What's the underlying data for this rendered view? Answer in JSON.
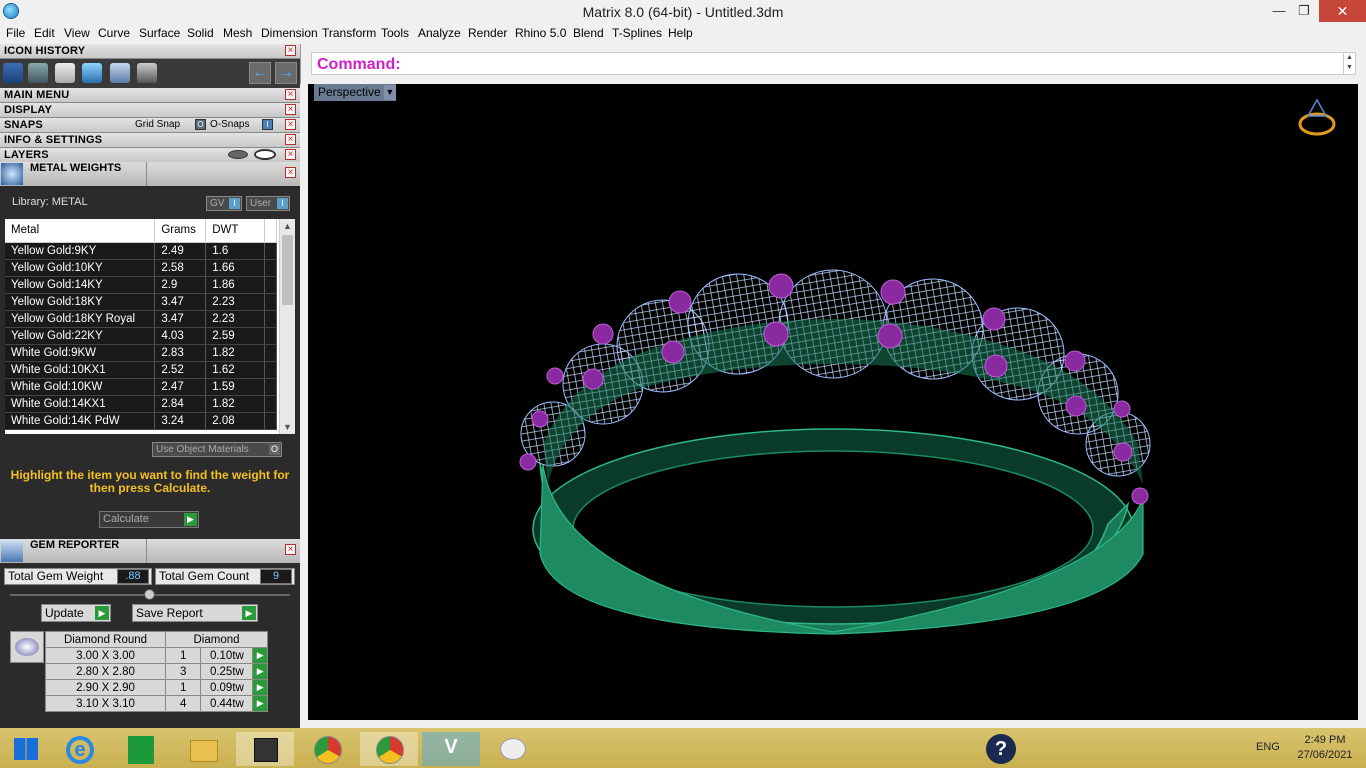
{
  "window": {
    "title": "Matrix 8.0 (64-bit) - Untitled.3dm",
    "minimize": "—",
    "restore": "❐",
    "close": "✕"
  },
  "menu": [
    "File",
    "Edit",
    "View",
    "Curve",
    "Surface",
    "Solid",
    "Mesh",
    "Dimension",
    "Transform",
    "Tools",
    "Analyze",
    "Render",
    "Rhino 5.0",
    "Blend",
    "T-Splines",
    "Help"
  ],
  "panels": {
    "icon_history": "ICON HISTORY",
    "main_menu": "MAIN MENU",
    "display": "DISPLAY",
    "snaps": "SNAPS",
    "grid_snap": "Grid Snap",
    "o_snaps": "O-Snaps",
    "info_settings": "INFO & SETTINGS",
    "layers": "LAYERS"
  },
  "metal_weights": {
    "title": "METAL WEIGHTS",
    "library": "Library: METAL",
    "gv_label": "GV",
    "user_label": "User",
    "columns": [
      "Metal",
      "Grams",
      "DWT"
    ],
    "rows": [
      [
        "Yellow Gold:9KY",
        "2.49",
        "1.6"
      ],
      [
        "Yellow Gold:10KY",
        "2.58",
        "1.66"
      ],
      [
        "Yellow Gold:14KY",
        "2.9",
        "1.86"
      ],
      [
        "Yellow Gold:18KY",
        "3.47",
        "2.23"
      ],
      [
        "Yellow Gold:18KY Royal",
        "3.47",
        "2.23"
      ],
      [
        "Yellow Gold:22KY",
        "4.03",
        "2.59"
      ],
      [
        "White Gold:9KW",
        "2.83",
        "1.82"
      ],
      [
        "White Gold:10KX1",
        "2.52",
        "1.62"
      ],
      [
        "White Gold:10KW",
        "2.47",
        "1.59"
      ],
      [
        "White Gold:14KX1",
        "2.84",
        "1.82"
      ],
      [
        "White Gold:14K PdW",
        "3.24",
        "2.08"
      ]
    ],
    "use_object_materials": "Use Object Materials",
    "hint": "Highlight the item you want to find the weight for then press Calculate.",
    "calculate": "Calculate"
  },
  "gem_reporter": {
    "title": "GEM REPORTER",
    "total_weight_label": "Total Gem Weight",
    "total_weight": ".88",
    "total_count_label": "Total Gem Count",
    "total_count": "9",
    "update": "Update",
    "save_report": "Save Report",
    "columns": [
      "Diamond Round",
      "Diamond"
    ],
    "rows": [
      [
        "3.00 X 3.00",
        "1",
        "0.10tw"
      ],
      [
        "2.80 X 2.80",
        "3",
        "0.25tw"
      ],
      [
        "2.90 X 2.90",
        "1",
        "0.09tw"
      ],
      [
        "3.10 X 3.10",
        "4",
        "0.44tw"
      ]
    ]
  },
  "command": {
    "label": "Command:"
  },
  "viewport": {
    "name": "Perspective"
  },
  "taskbar": {
    "lang": "ENG",
    "time": "2:49 PM",
    "date": "27/06/2021"
  },
  "colors": {
    "metal": "#1a7a58",
    "gem": "#8ab4ff",
    "prong": "#8a2aa0",
    "hint": "#f4c020",
    "command": "#d020c8"
  }
}
